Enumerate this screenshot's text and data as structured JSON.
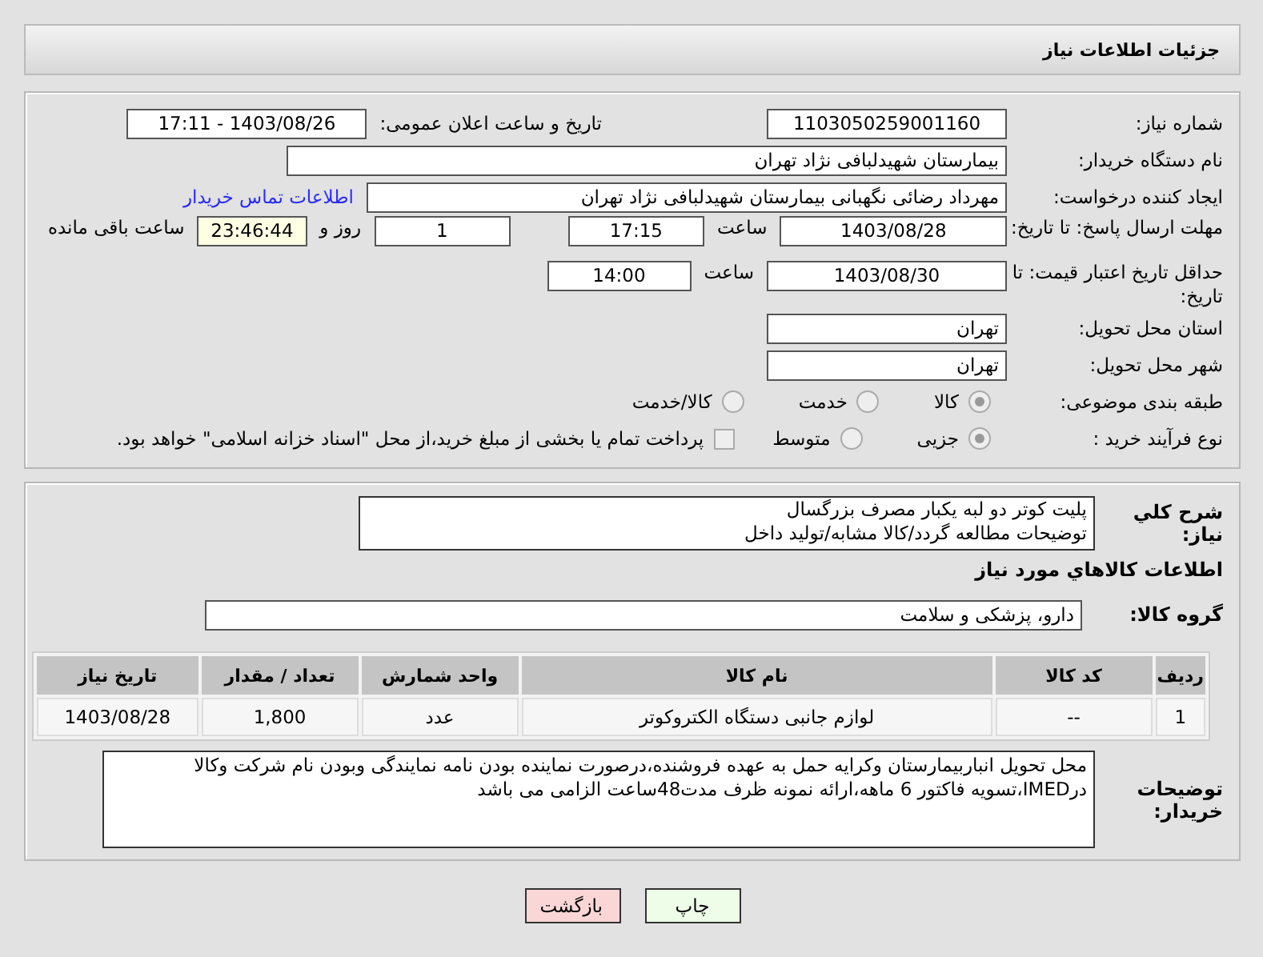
{
  "header": {
    "title": "جزئیات اطلاعات نیاز"
  },
  "need_number": {
    "label": "شماره نیاز:",
    "value": "1103050259001160"
  },
  "announce": {
    "label": "تاریخ و ساعت اعلان عمومی:",
    "value": "1403/08/26 - 17:11"
  },
  "buyer_org": {
    "label": "نام دستگاه خریدار:",
    "value": "بیمارستان شهیدلبافی نژاد تهران"
  },
  "requester": {
    "label": "ایجاد کننده درخواست:",
    "value": "مهرداد رضائی نگهبانی بیمارستان شهیدلبافی نژاد تهران",
    "link": "اطلاعات تماس خریدار"
  },
  "reply_deadline": {
    "label": "مهلت ارسال پاسخ: تا تاریخ:",
    "date": "1403/08/28",
    "time_label": "ساعت",
    "time": "17:15",
    "days": "1",
    "days_label": "روز و",
    "remaining": "23:46:44",
    "remaining_label": "ساعت باقی مانده"
  },
  "price_validity": {
    "label": "حداقل تاریخ اعتبار قیمت: تا تاریخ:",
    "date": "1403/08/30",
    "time_label": "ساعت",
    "time": "14:00"
  },
  "province": {
    "label": "استان محل تحویل:",
    "value": "تهران"
  },
  "city": {
    "label": "شهر محل تحویل:",
    "value": "تهران"
  },
  "category": {
    "label": "طبقه بندی موضوعی:",
    "options": [
      {
        "label": "کالا",
        "selected": true
      },
      {
        "label": "خدمت",
        "selected": false
      },
      {
        "label": "کالا/خدمت",
        "selected": false
      }
    ]
  },
  "process": {
    "label": "نوع فرآیند خرید :",
    "options": [
      {
        "label": "جزیی",
        "selected": true
      },
      {
        "label": "متوسط",
        "selected": false
      }
    ],
    "treasury": {
      "label": "پرداخت تمام یا بخشی از مبلغ خرید،از محل \"اسناد خزانه اسلامی\" خواهد بود.",
      "checked": false
    }
  },
  "description": {
    "label": "شرح کلي نیاز:",
    "value": "پلیت کوتر دو لبه یکبار مصرف بزرگسال\nتوضیحات مطالعه گردد/کالا مشابه/تولید داخل"
  },
  "goods_title": "اطلاعات کالاهاي مورد نیاز",
  "goods_group": {
    "label": "گروه کالا:",
    "value": "دارو، پزشکی و سلامت"
  },
  "table": {
    "columns": [
      "ردیف",
      "کد کالا",
      "نام کالا",
      "واحد شمارش",
      "تعداد / مقدار",
      "تاریخ نیاز"
    ],
    "rows": [
      [
        "1",
        "--",
        "لوازم جانبی دستگاه الکتروکوتر",
        "عدد",
        "1,800",
        "1403/08/28"
      ]
    ]
  },
  "buyer_notes": {
    "label": "توضیحات خریدار:",
    "value": "محل تحویل انباربیمارستان وکرایه حمل به عهده فروشنده،درصورت نماینده بودن نامه نمایندگی وبودن نام شرکت وکالا درIMED،تسویه فاکتور 6 ماهه،ارائه نمونه ظرف مدت48ساعت الزامی می باشد"
  },
  "buttons": [
    {
      "label": "چاپ",
      "kind": "print"
    },
    {
      "label": "بازگشت",
      "kind": "back"
    }
  ]
}
